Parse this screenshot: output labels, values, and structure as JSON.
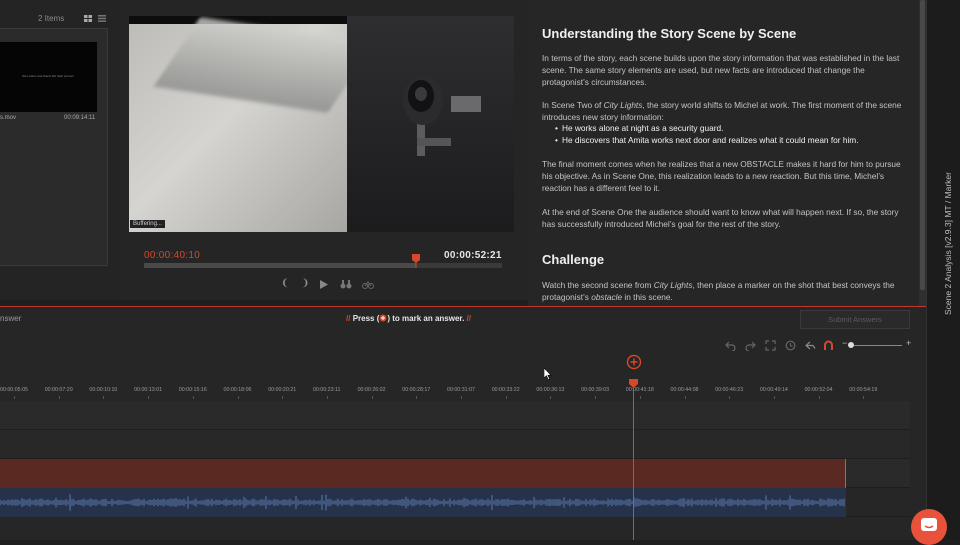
{
  "media_bin": {
    "item_count": "2 Items",
    "clip_caption": "We Linden and Starts We Stell premier",
    "clip_name": "s.mov",
    "clip_duration": "00:09:14:11"
  },
  "player": {
    "buffering": "Buffering...",
    "current_time": "00:00:40:10",
    "total_time": "00:00:52:21",
    "progress": 0.76
  },
  "article": {
    "heading": "Understanding the Story Scene by Scene",
    "p1": "In terms of the story, each scene builds upon the story information that was established in the last scene. The same story elements are used, but new facts are introduced that change the protagonist’s circumstances.",
    "p2_pre": "In Scene Two of ",
    "p2_title": "City Lights",
    "p2_post": ", the story world shifts to Michel at work. The first moment of the scene introduces new story information:",
    "bullets": [
      "He works alone at night as a security guard.",
      "He discovers that Amita works next door and realizes what it could mean for him."
    ],
    "p3": "The final moment comes when he realizes that a new OBSTACLE makes it hard for him to pursue his objective. As in Scene One, this realization leads to a new reaction. But this time, Michel’s reaction has a different feel to it.",
    "p4": "At the end of Scene One the audience should want to know what will happen next. If so, the story has successfully introduced Michel’s goal for the rest of the story.",
    "challenge_heading": "Challenge",
    "c_pre": "Watch the second scene from ",
    "c_title": "City Lights",
    "c_mid": ", then place a marker on the shot that best conveys the protagonist’s ",
    "c_em": "obstacle",
    "c_post": " in this scene."
  },
  "sidebar": {
    "title": "Scene 2 Analysis [v2.9.3] MT / Marker"
  },
  "timeline": {
    "answer_label": "nswer",
    "press_pre": "Press (",
    "press_post": ") to mark an answer.",
    "slashes": "//",
    "submit_label": "Submit Answers",
    "ticks": [
      "00:00:05:05",
      "00:00:07:20",
      "00:00:10:10",
      "00:00:13:01",
      "00:00:15:16",
      "00:00:18:06",
      "00:00:20:21",
      "00:00:23:11",
      "00:00:26:02",
      "00:00:28:17",
      "00:00:31:07",
      "00:00:33:22",
      "00:00:36:13",
      "00:00:39:03",
      "00:00:41:18",
      "00:00:44:08",
      "00:00:46:23",
      "00:00:49:14",
      "00:00:52:04",
      "00:00:54:19"
    ]
  },
  "colors": {
    "accent": "#d9472b",
    "video_clip": "#5a2a22",
    "audio_clip": "#25324a"
  }
}
